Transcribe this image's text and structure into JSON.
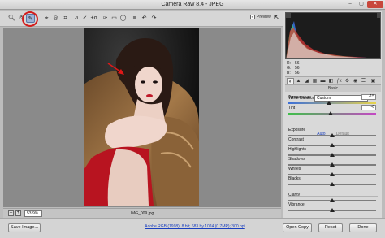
{
  "window": {
    "title": "Camera Raw 8.4  -  JPEG",
    "minimize": "–",
    "maximize": "▢",
    "close": "✕"
  },
  "toolbar": {
    "tools": [
      {
        "name": "zoom-tool-icon",
        "glyph": "🔍︎"
      },
      {
        "name": "hand-tool-icon",
        "glyph": "✋︎"
      },
      {
        "name": "white-balance-tool-icon",
        "glyph": "✎"
      },
      {
        "name": "color-sampler-tool-icon",
        "glyph": "⌖"
      },
      {
        "name": "targeted-adjustment-tool-icon",
        "glyph": "◎"
      },
      {
        "name": "crop-tool-icon",
        "glyph": "⌗"
      },
      {
        "name": "straighten-tool-icon",
        "glyph": "⊿"
      },
      {
        "name": "spot-removal-tool-icon",
        "glyph": "✓"
      },
      {
        "name": "red-eye-removal-tool-icon",
        "glyph": "+o"
      },
      {
        "name": "adjustment-brush-icon",
        "glyph": "✑"
      },
      {
        "name": "graduated-filter-icon",
        "glyph": "▭"
      },
      {
        "name": "radial-filter-icon",
        "glyph": "◯"
      },
      {
        "name": "preferences-icon",
        "glyph": "≡"
      },
      {
        "name": "rotate-left-icon",
        "glyph": "↶"
      },
      {
        "name": "rotate-right-icon",
        "glyph": "↷"
      }
    ],
    "preview_label": "Preview",
    "preview_checked": "✓",
    "fullscreen_glyph": "⇱"
  },
  "histogram": {
    "r_label": "R:",
    "g_label": "G:",
    "b_label": "B:",
    "r": "56",
    "g": "56",
    "b": "56"
  },
  "panel": {
    "tabs": [
      "◐",
      "▲",
      "◢",
      "▦",
      "▬",
      "◧",
      "ƒx",
      "⚙",
      "◉",
      "☰",
      "▣"
    ],
    "section": "Basic",
    "white_balance_label": "White Balance:",
    "white_balance_value": "Custom",
    "auto": "Auto",
    "default": "Default",
    "sliders": [
      {
        "label": "Temperature",
        "value": "-15",
        "pos": 0.46
      },
      {
        "label": "Tint",
        "value": "-6",
        "pos": 0.48
      },
      {
        "label": "Exposure",
        "value": "",
        "pos": 0.5
      },
      {
        "label": "Contrast",
        "value": "",
        "pos": 0.5
      },
      {
        "label": "Highlights",
        "value": "",
        "pos": 0.5
      },
      {
        "label": "Shadows",
        "value": "",
        "pos": 0.5
      },
      {
        "label": "Whites",
        "value": "",
        "pos": 0.5
      },
      {
        "label": "Blacks",
        "value": "",
        "pos": 0.5
      },
      {
        "label": "Clarity",
        "value": "",
        "pos": 0.5
      },
      {
        "label": "Vibrance",
        "value": "",
        "pos": 0.5
      }
    ]
  },
  "status": {
    "zoom_out": "–",
    "zoom_in": "+",
    "zoom": "53.9%",
    "filename": "IMG_009.jpg"
  },
  "bottom": {
    "save_image": "Save Image...",
    "workflow_link": "Adobe RGB (1998); 8 bit; 683 by 1024 (0.7MP); 300 ppi",
    "open_copy": "Open Copy",
    "reset": "Reset",
    "done": "Done"
  }
}
